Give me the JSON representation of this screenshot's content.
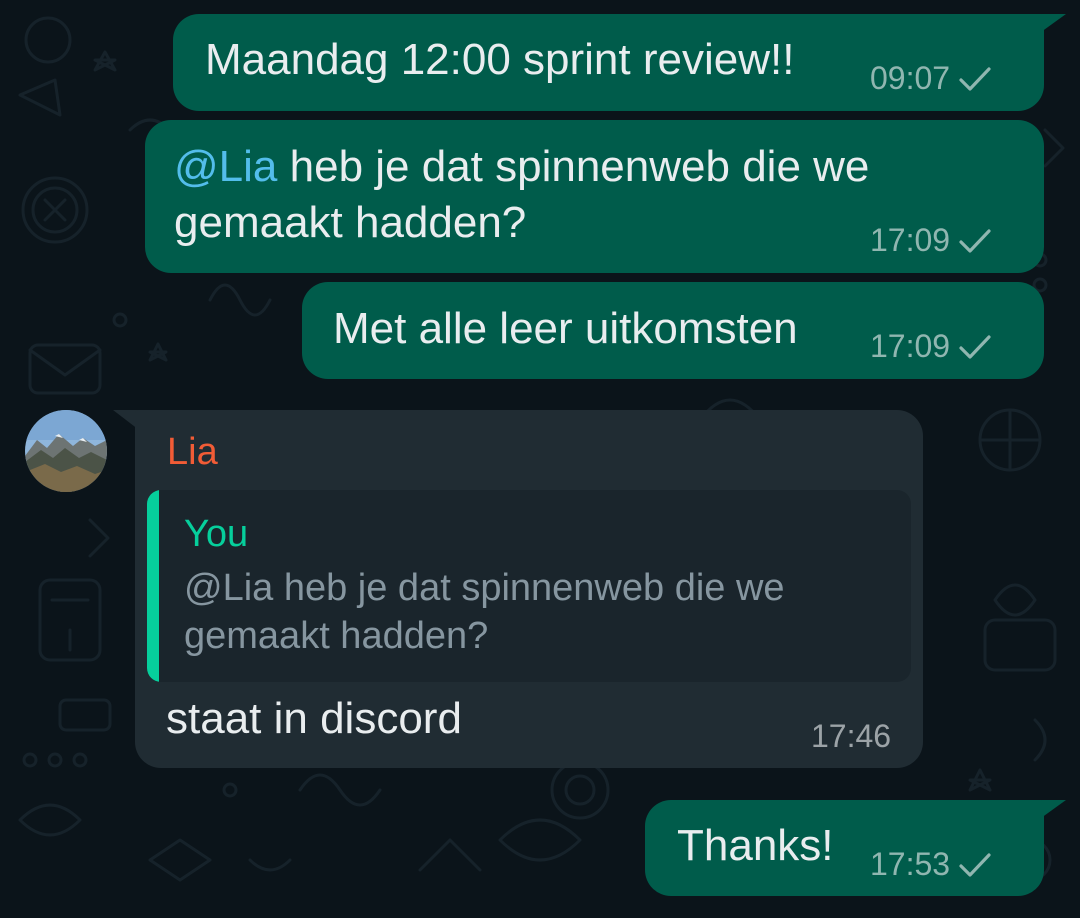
{
  "theme": {
    "background": "#0b141a",
    "outgoing_bubble": "#005c4b",
    "incoming_bubble": "#202c33",
    "mention_color": "#53bdeb",
    "sender_color": "#f15c36",
    "quote_accent": "#06cf9c"
  },
  "messages": [
    {
      "direction": "outgoing",
      "text": "Maandag 12:00 sprint review!!",
      "time": "09:07",
      "status_icon": "single-check-icon"
    },
    {
      "direction": "outgoing",
      "mention": "@Lia",
      "text_line1": "heb je dat spinnenweb die we",
      "text_line2": "gemaakt hadden?",
      "time": "17:09",
      "status_icon": "single-check-icon"
    },
    {
      "direction": "outgoing",
      "text": "Met alle leer uitkomsten",
      "time": "17:09",
      "status_icon": "single-check-icon"
    },
    {
      "direction": "incoming",
      "sender": "Lia",
      "avatar_icon": "mountain-photo-avatar",
      "quote": {
        "author": "You",
        "line1": "@Lia heb je dat spinnenweb die we",
        "line2": "gemaakt hadden?"
      },
      "text": "staat in discord",
      "time": "17:46"
    },
    {
      "direction": "outgoing",
      "text": "Thanks!",
      "time": "17:53",
      "status_icon": "single-check-icon"
    }
  ]
}
